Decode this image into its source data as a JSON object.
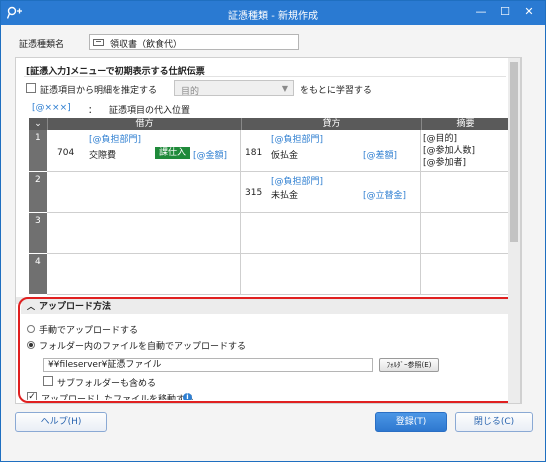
{
  "window": {
    "title": "証憑種類 - 新規作成",
    "min_glyph": "—",
    "max_glyph": "☐",
    "close_glyph": "✕"
  },
  "voucher_type": {
    "label": "証憑種類名",
    "value": "領収書（飲食代）"
  },
  "initial_entry": {
    "section_title": "[証憑入力]メニューで初期表示する仕訳伝票",
    "estimate_label": "証憑項目から明細を推定する",
    "estimate_checked": false,
    "learn_select_value": "目的",
    "learn_suffix": "をもとに学習する",
    "placeholder_tag": "[@×××]",
    "placeholder_colon": "：",
    "placeholder_desc": "証憑項目の代入位置"
  },
  "grid": {
    "headers": {
      "debit": "借方",
      "credit": "貸方",
      "summary": "摘要"
    },
    "rows": [
      {
        "num": "1",
        "debit_dept": "[@負担部門]",
        "debit_code": "704",
        "debit_account": "交際費",
        "debit_tax_badge": "課仕入",
        "debit_amount": "[@金額]",
        "credit_dept": "[@負担部門]",
        "credit_code": "181",
        "credit_account": "仮払金",
        "credit_amount": "[@差額]",
        "summary": [
          "[@目的]",
          "[@参加人数]",
          "[@参加者]"
        ]
      },
      {
        "num": "2",
        "credit_dept": "[@負担部門]",
        "credit_code": "315",
        "credit_account": "未払金",
        "credit_amount": "[@立替金]"
      },
      {
        "num": "3"
      },
      {
        "num": "4"
      }
    ]
  },
  "upload": {
    "title": "アップロード方法",
    "manual_label": "手動でアップロードする",
    "auto_label": "フォルダー内のファイルを自動でアップロードする",
    "selected": "auto",
    "folder_path": "¥¥fileserver¥証憑ファイル",
    "browse_label": "ﾌｫﾙﾀﾞｰ参照(E)",
    "include_subfolders_label": "サブフォルダーも含める",
    "include_subfolders": false,
    "move_after_label": "アップロードしたファイルを移動する",
    "move_after": true,
    "info_glyph": "i"
  },
  "buttons": {
    "help": "ヘルプ(H)",
    "register": "登録(T)",
    "close": "閉じる(C)"
  }
}
